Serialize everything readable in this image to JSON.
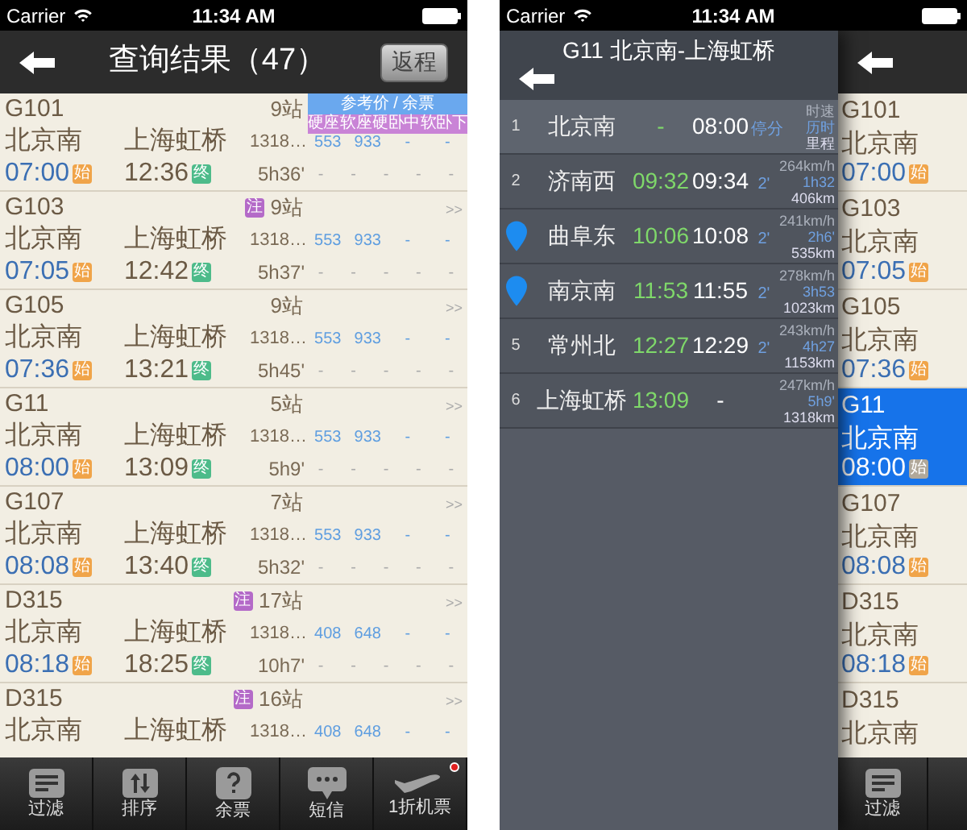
{
  "left_screen": {
    "status_bar": {
      "carrier": "Carrier",
      "time": "11:34 AM"
    },
    "nav_bar": {
      "title": "查询结果（47）",
      "return_button": "返程"
    },
    "price_header": {
      "title": "参考价 / 余票",
      "seat_types": [
        "硬座",
        "软座",
        "硬卧中",
        "软卧下"
      ]
    },
    "trains": [
      {
        "number": "G101",
        "stations": "9站",
        "from": "北京南",
        "to": "上海虹桥",
        "distance": "1318…",
        "prices": [
          "553",
          "933",
          "-",
          "-"
        ],
        "depart": "07:00",
        "start_badge": "始",
        "arrive": "12:36",
        "end_badge": "终",
        "duration": "5h36'",
        "availability": [
          "-",
          "-",
          "-",
          "-",
          "-"
        ]
      },
      {
        "number": "G103",
        "note_badge": "注",
        "stations": "9站",
        "more": ">>",
        "from": "北京南",
        "to": "上海虹桥",
        "distance": "1318…",
        "prices": [
          "553",
          "933",
          "-",
          "-"
        ],
        "depart": "07:05",
        "start_badge": "始",
        "arrive": "12:42",
        "end_badge": "终",
        "duration": "5h37'",
        "availability": [
          "-",
          "-",
          "-",
          "-",
          "-"
        ]
      },
      {
        "number": "G105",
        "stations": "9站",
        "more": ">>",
        "from": "北京南",
        "to": "上海虹桥",
        "distance": "1318…",
        "prices": [
          "553",
          "933",
          "-",
          "-"
        ],
        "depart": "07:36",
        "start_badge": "始",
        "arrive": "13:21",
        "end_badge": "终",
        "duration": "5h45'",
        "availability": [
          "-",
          "-",
          "-",
          "-",
          "-"
        ]
      },
      {
        "number": "G11",
        "stations": "5站",
        "more": ">>",
        "from": "北京南",
        "to": "上海虹桥",
        "distance": "1318…",
        "prices": [
          "553",
          "933",
          "-",
          "-"
        ],
        "depart": "08:00",
        "start_badge": "始",
        "arrive": "13:09",
        "end_badge": "终",
        "duration": "5h9'",
        "availability": [
          "-",
          "-",
          "-",
          "-",
          "-"
        ]
      },
      {
        "number": "G107",
        "stations": "7站",
        "more": ">>",
        "from": "北京南",
        "to": "上海虹桥",
        "distance": "1318…",
        "prices": [
          "553",
          "933",
          "-",
          "-"
        ],
        "depart": "08:08",
        "start_badge": "始",
        "arrive": "13:40",
        "end_badge": "终",
        "duration": "5h32'",
        "availability": [
          "-",
          "-",
          "-",
          "-",
          "-"
        ]
      },
      {
        "number": "D315",
        "note_badge": "注",
        "stations": "17站",
        "more": ">>",
        "from": "北京南",
        "to": "上海虹桥",
        "distance": "1318…",
        "prices": [
          "408",
          "648",
          "-",
          "-"
        ],
        "depart": "08:18",
        "start_badge": "始",
        "arrive": "18:25",
        "end_badge": "终",
        "duration": "10h7'",
        "availability": [
          "-",
          "-",
          "-",
          "-",
          "-"
        ]
      },
      {
        "number": "D315",
        "note_badge": "注",
        "stations": "16站",
        "more": ">>",
        "from": "北京南",
        "to": "上海虹桥",
        "distance": "1318…",
        "prices": [
          "408",
          "648",
          "-",
          "-"
        ]
      }
    ],
    "tab_bar": [
      {
        "label": "过滤",
        "kind": "filter",
        "alert": false
      },
      {
        "label": "排序",
        "kind": "sort",
        "alert": false
      },
      {
        "label": "余票",
        "kind": "question",
        "alert": false
      },
      {
        "label": "短信",
        "kind": "message",
        "alert": false
      },
      {
        "label": "1折机票",
        "kind": "plane",
        "alert": true
      }
    ]
  },
  "right_screen": {
    "status_bar": {
      "carrier": "Carrier",
      "time": "11:34 AM"
    },
    "detail_panel": {
      "title": "G11 北京南-上海虹桥",
      "stops": [
        {
          "kind": "number",
          "index": "1",
          "station": "北京南",
          "arrive": "-",
          "depart": "08:00",
          "stop": "停分",
          "stats": [
            "时速",
            "历时",
            "里程"
          ]
        },
        {
          "kind": "number",
          "index": "2",
          "station": "济南西",
          "arrive": "09:32",
          "depart": "09:34",
          "stop": "2'",
          "stats": [
            "264km/h",
            "1h32",
            "406km"
          ]
        },
        {
          "kind": "pin",
          "station": "曲阜东",
          "arrive": "10:06",
          "depart": "10:08",
          "stop": "2'",
          "stats": [
            "241km/h",
            "2h6'",
            "535km"
          ]
        },
        {
          "kind": "pin",
          "station": "南京南",
          "arrive": "11:53",
          "depart": "11:55",
          "stop": "2'",
          "stats": [
            "278km/h",
            "3h53",
            "1023km"
          ]
        },
        {
          "kind": "number",
          "index": "5",
          "station": "常州北",
          "arrive": "12:27",
          "depart": "12:29",
          "stop": "2'",
          "stats": [
            "243km/h",
            "4h27",
            "1153km"
          ]
        },
        {
          "kind": "number",
          "index": "6",
          "station": "上海虹桥",
          "arrive": "13:09",
          "depart": "-",
          "stats": [
            "247km/h",
            "5h9'",
            "1318km"
          ]
        }
      ]
    },
    "back_list": {
      "trains": [
        {
          "number": "G101",
          "from": "北京南",
          "depart": "07:00",
          "start_badge": "始",
          "selected": false
        },
        {
          "number": "G103",
          "from": "北京南",
          "depart": "07:05",
          "start_badge": "始",
          "selected": false
        },
        {
          "number": "G105",
          "from": "北京南",
          "depart": "07:36",
          "start_badge": "始",
          "selected": false
        },
        {
          "number": "G11",
          "from": "北京南",
          "depart": "08:00",
          "start_badge": "始",
          "selected": true
        },
        {
          "number": "G107",
          "from": "北京南",
          "depart": "08:08",
          "start_badge": "始",
          "selected": false
        },
        {
          "number": "D315",
          "from": "北京南",
          "depart": "08:18",
          "start_badge": "始",
          "selected": false
        },
        {
          "number": "D315",
          "from": "北京南",
          "selected": false
        }
      ],
      "tab": {
        "label": "过滤",
        "kind": "filter"
      }
    }
  }
}
